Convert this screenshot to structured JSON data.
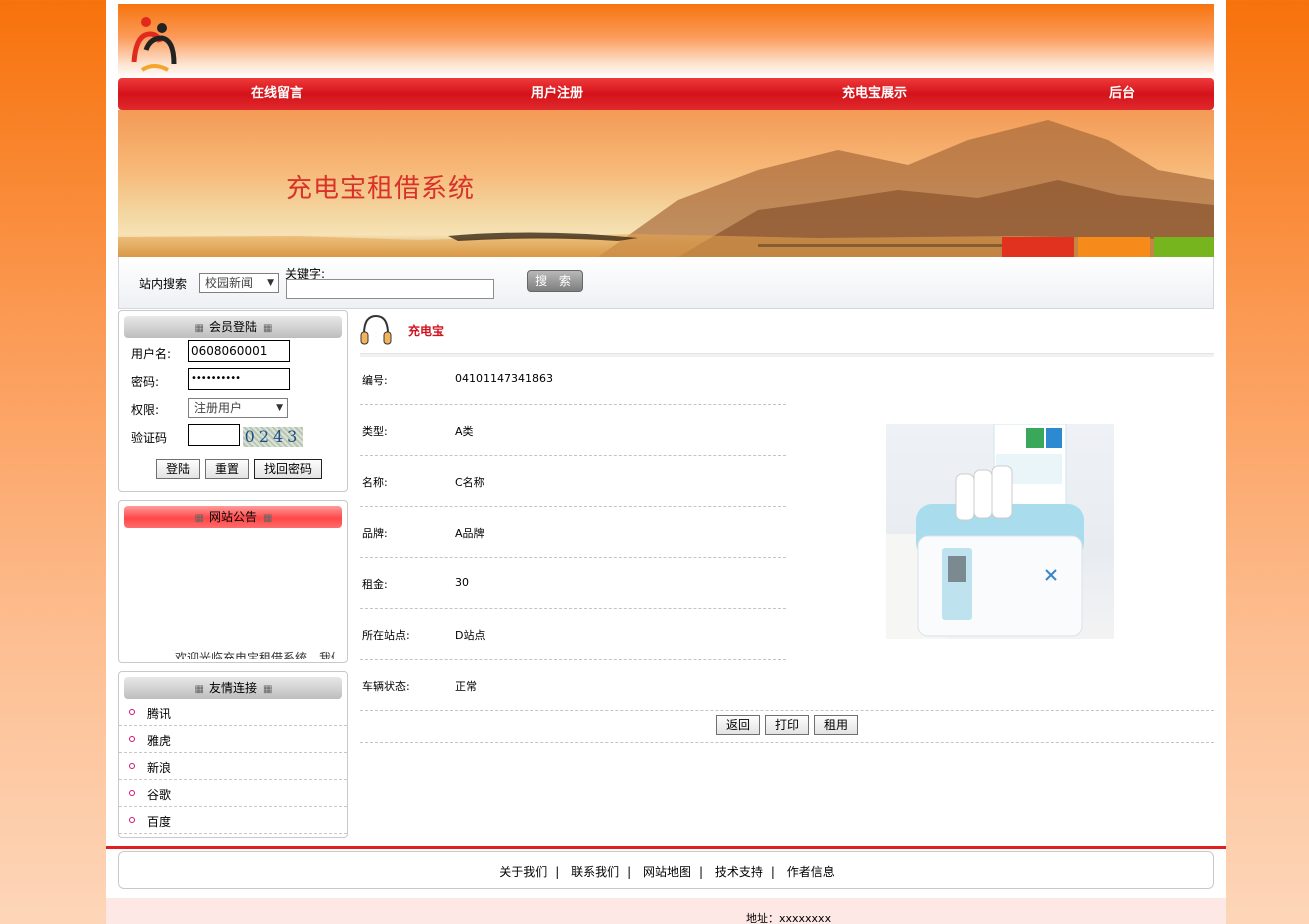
{
  "nav": {
    "items": [
      {
        "label": "在线留言"
      },
      {
        "label": "用户注册"
      },
      {
        "label": "充电宝展示"
      },
      {
        "label": "后台"
      }
    ]
  },
  "banner": {
    "title": "充电宝租借系统"
  },
  "search": {
    "label": "站内搜索",
    "category_selected": "校园新闻",
    "keyword_label": "关键字:",
    "keyword_value": "",
    "button_label": "搜 索"
  },
  "login": {
    "header": "会员登陆",
    "username_label": "用户名:",
    "username_value": "0608060001",
    "password_label": "密码:",
    "password_value": "••••••••••",
    "role_label": "权限:",
    "role_selected": "注册用户",
    "captcha_label": "验证码",
    "captcha_value": "",
    "captcha_image_text": "0243",
    "login_button": "登陆",
    "reset_button": "重置",
    "recover_button": "找回密码"
  },
  "notice": {
    "header": "网站公告",
    "scroll_text": "欢迎光临充电宝租借系统，我们本着"
  },
  "links": {
    "header": "友情连接",
    "items": [
      "腾讯",
      "雅虎",
      "新浪",
      "谷歌",
      "百度"
    ]
  },
  "detail": {
    "title": "充电宝",
    "fields": [
      {
        "key": "编号:",
        "value": "04101147341863"
      },
      {
        "key": "类型:",
        "value": "A类"
      },
      {
        "key": "名称:",
        "value": "C名称"
      },
      {
        "key": "品牌:",
        "value": "A品牌"
      },
      {
        "key": "租金:",
        "value": "30"
      },
      {
        "key": "所在站点:",
        "value": "D站点"
      },
      {
        "key": "车辆状态:",
        "value": "正常"
      }
    ],
    "back_button": "返回",
    "print_button": "打印",
    "rent_button": "租用"
  },
  "footer": {
    "links": [
      "关于我们",
      "联系我们",
      "网站地图",
      "技术支持",
      "作者信息"
    ],
    "separator": "|",
    "address": "地址：xxxxxxxx"
  },
  "colors": {
    "nav_red": "#d4121a",
    "title_red": "#d2121f",
    "orange": "#f7720b"
  }
}
